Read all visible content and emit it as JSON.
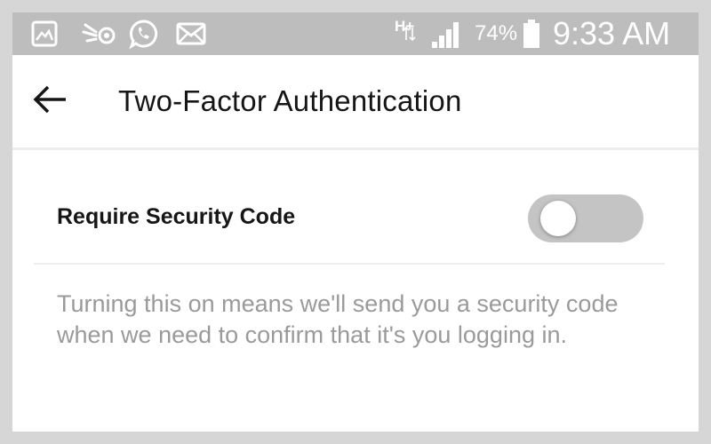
{
  "status_bar": {
    "icons": [
      "gallery-icon",
      "signal-app-icon",
      "whatsapp-icon",
      "mail-icon"
    ],
    "network": "H+",
    "battery": "74%",
    "time": "9:33 AM"
  },
  "header": {
    "back_icon": "arrow-left-icon",
    "title": "Two-Factor Authentication"
  },
  "setting": {
    "label": "Require Security Code",
    "enabled": false,
    "description": "Turning this on means we'll send you a security code when we need to confirm that it's you logging in."
  },
  "colors": {
    "status_bar": "#bdbdbd",
    "toggle_track_off": "#c4c4c4",
    "description_text": "#9a9a9a"
  }
}
